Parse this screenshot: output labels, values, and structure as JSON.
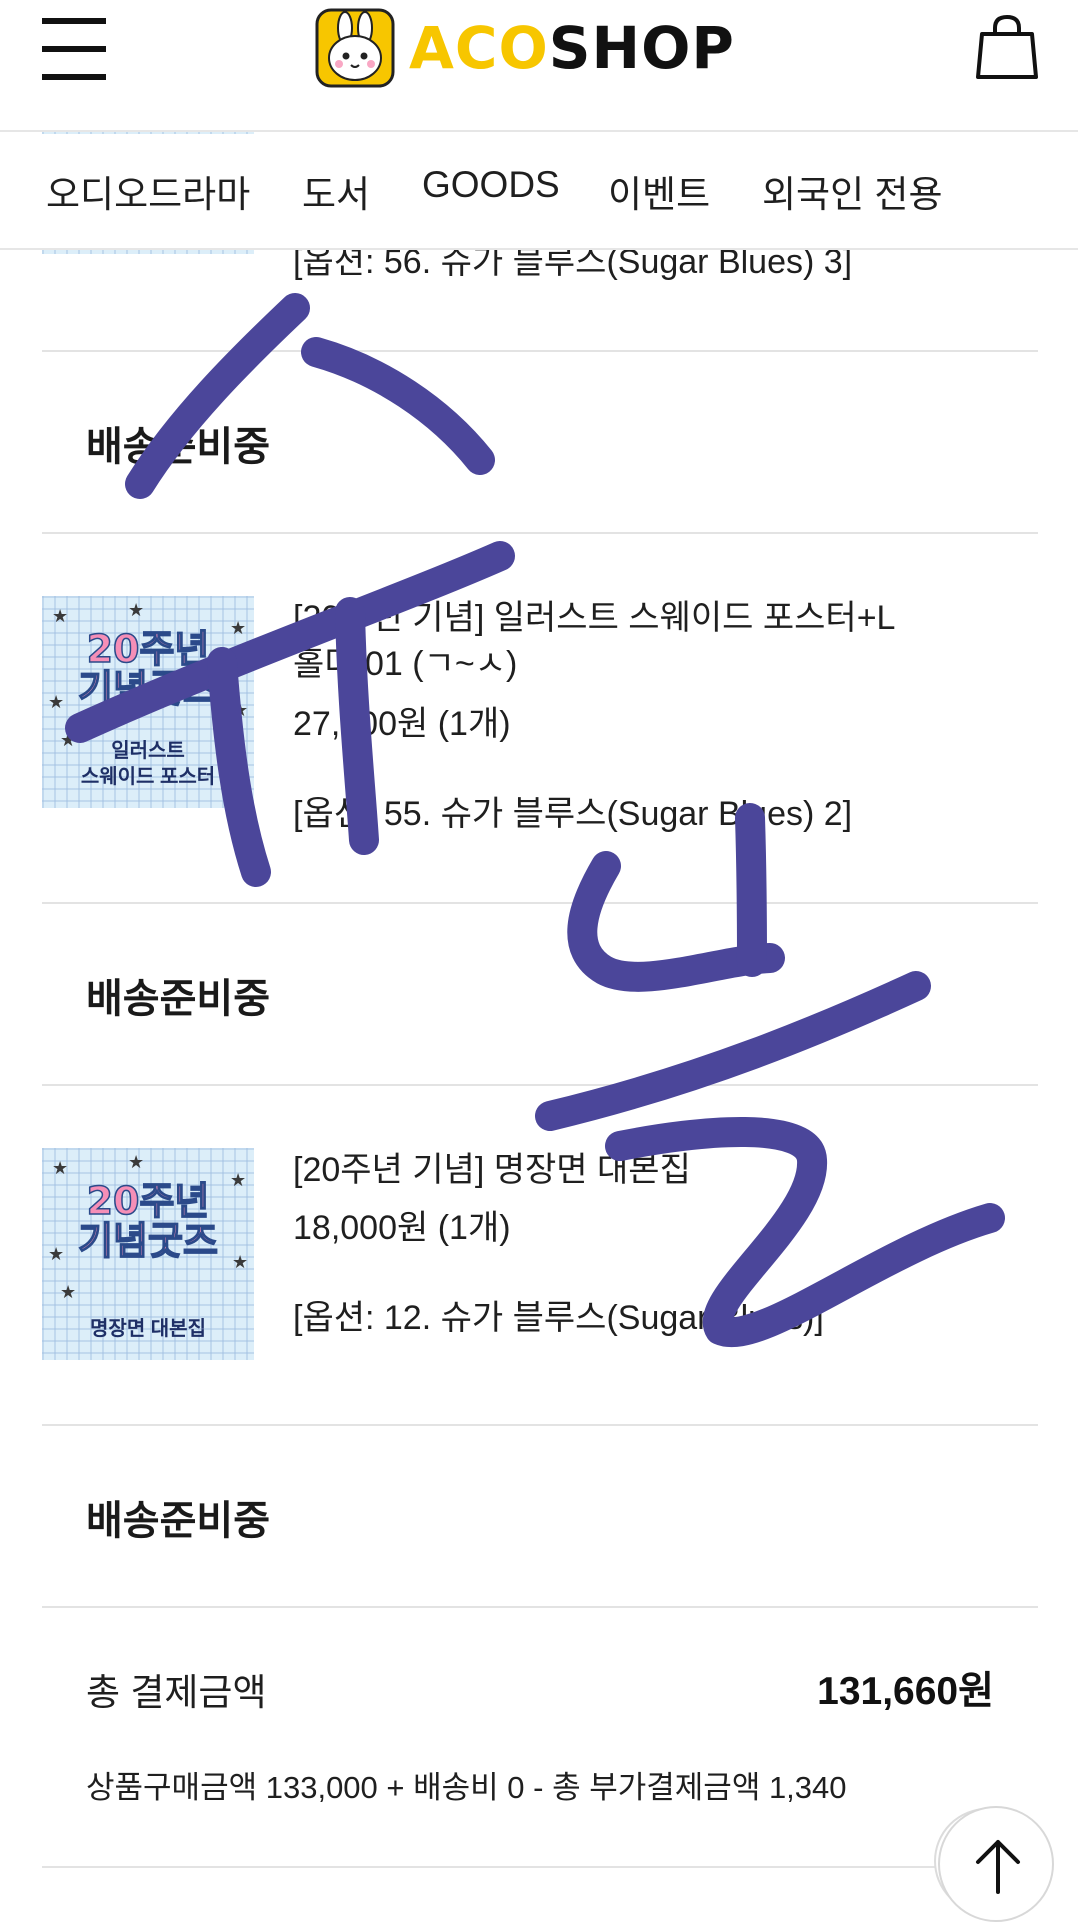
{
  "header": {
    "logo_aco": "ACO",
    "logo_shop": "SHOP"
  },
  "nav": {
    "items": [
      "오디오드라마",
      "도서",
      "GOODS",
      "이벤트",
      "외국인 전용"
    ]
  },
  "orders": [
    {
      "option": "[옵션: 56. 슈가 블루스(Sugar Blues) 3]",
      "status": "배송준비중"
    },
    {
      "thumb_badge": "20주년\n기념굿즈",
      "thumb_sub": "일러스트\n스웨이드 포스터",
      "title_line1": "[20주년 기념] 일러스트 스웨이드 포스터+L",
      "title_line2": "홀더 01 (ㄱ~ㅅ)",
      "price": "27,000원 (1개)",
      "option": "[옵션: 55. 슈가 블루스(Sugar Blues) 2]",
      "status": "배송준비중"
    },
    {
      "thumb_badge": "20주년\n기념굿즈",
      "thumb_sub": "명장면 대본집",
      "title_line1": "[20주년 기념] 명장면 대본집",
      "price": "18,000원 (1개)",
      "option": "[옵션: 12. 슈가 블루스(Sugar Blues)]",
      "status": "배송준비중"
    }
  ],
  "summary": {
    "total_label": "총 결제금액",
    "total_value": "131,660원",
    "breakdown": "상품구매금액 133,000 + 배송비 0 - 총 부가결제금액 1,340"
  },
  "colors": {
    "logo_yellow": "#f7c600",
    "scribble": "#4b469a"
  },
  "icons": {
    "menu": "hamburger-menu-icon",
    "cart": "shopping-bag-icon",
    "scroll_top": "arrow-up-icon"
  }
}
